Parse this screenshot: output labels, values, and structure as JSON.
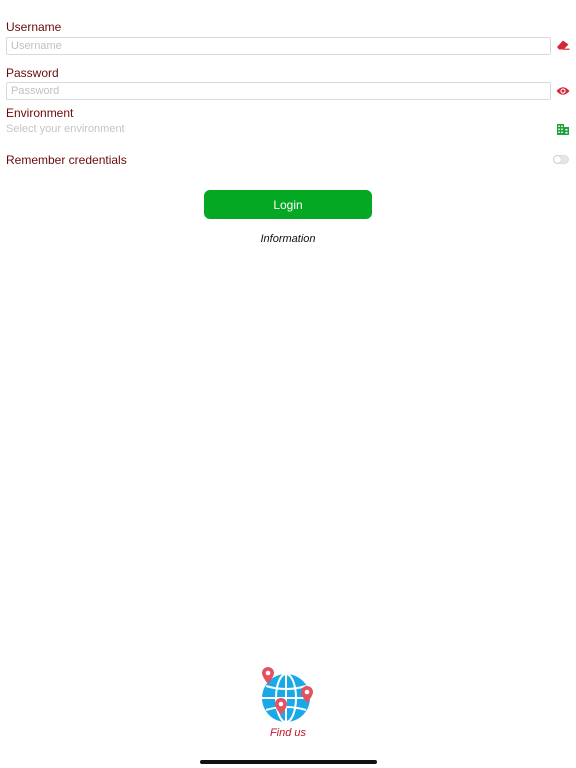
{
  "form": {
    "username": {
      "label": "Username",
      "value": "",
      "placeholder": "Username",
      "icon": "eraser-icon"
    },
    "password": {
      "label": "Password",
      "value": "",
      "placeholder": "Password",
      "icon": "eye-icon"
    },
    "environment": {
      "label": "Environment",
      "placeholder": "Select your environment",
      "icon": "building-icon"
    },
    "remember": {
      "label": "Remember credentials",
      "checked": false
    },
    "login_label": "Login",
    "information_label": "Information"
  },
  "footer": {
    "find_us_label": "Find us",
    "icon": "globe-map-pins-icon"
  },
  "colors": {
    "label": "#6b0a0a",
    "accent_red": "#d6263a",
    "login_green": "#05a823",
    "building_green": "#1ea33a",
    "globe_blue": "#1aa9e8"
  }
}
